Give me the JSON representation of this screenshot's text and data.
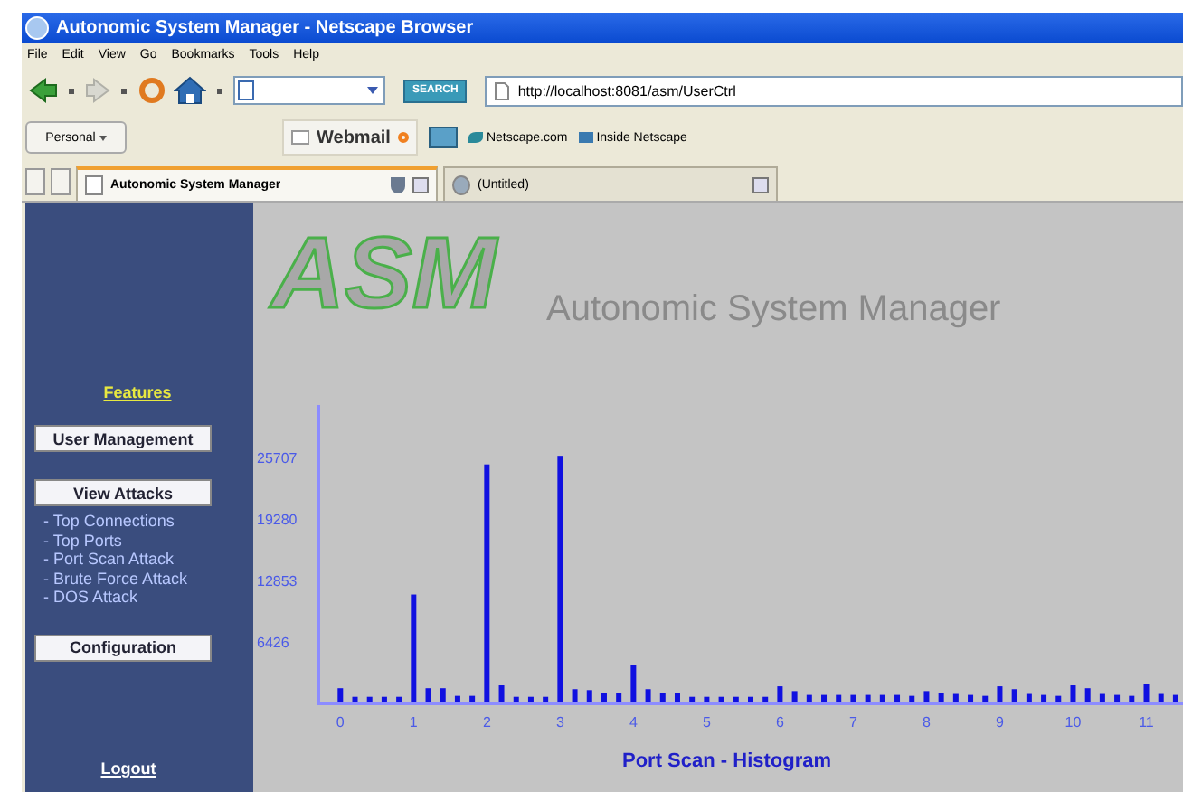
{
  "window": {
    "title": "Autonomic System Manager - Netscape Browser"
  },
  "menu": [
    "File",
    "Edit",
    "View",
    "Go",
    "Bookmarks",
    "Tools",
    "Help"
  ],
  "toolbar": {
    "search_button": "SEARCH",
    "address": "http://localhost:8081/asm/UserCtrl"
  },
  "personal_toolbar": {
    "personal": "Personal",
    "webmail": "Webmail",
    "links": [
      "Netscape.com",
      "Inside Netscape"
    ]
  },
  "tabs": [
    {
      "label": "Autonomic System Manager",
      "selected": true
    },
    {
      "label": "(Untitled)",
      "selected": false
    }
  ],
  "sidebar": {
    "items": [
      {
        "kind": "heading",
        "label": "Features"
      },
      {
        "kind": "button",
        "label": "User Management"
      },
      {
        "kind": "button",
        "label": "View Attacks"
      },
      {
        "kind": "link",
        "label": "- Top Connections"
      },
      {
        "kind": "link",
        "label": "- Top Ports"
      },
      {
        "kind": "link",
        "label": "- Port Scan Attack"
      },
      {
        "kind": "link",
        "label": "- Brute Force Attack"
      },
      {
        "kind": "link",
        "label": "- DOS Attack"
      },
      {
        "kind": "button",
        "label": "Configuration"
      },
      {
        "kind": "logout",
        "label": "Logout"
      }
    ]
  },
  "header": {
    "logo": "ASM",
    "title": "Autonomic System Manager"
  },
  "histogram": {
    "chart_data": {
      "type": "bar",
      "title": "Port Scan - Histogram",
      "x": [
        0,
        0.2,
        0.4,
        0.6,
        0.8,
        1,
        1.2,
        1.4,
        1.6,
        1.8,
        2,
        2.2,
        2.4,
        2.6,
        2.8,
        3,
        3.2,
        3.4,
        3.6,
        3.8,
        4,
        4.2,
        4.4,
        4.6,
        4.8,
        5,
        5.2,
        5.4,
        5.6,
        5.8,
        6,
        6.2,
        6.4,
        6.6,
        6.8,
        7,
        7.2,
        7.4,
        7.6,
        7.8,
        8,
        8.2,
        8.4,
        8.6,
        8.8,
        9,
        9.2,
        9.4,
        9.6,
        9.8,
        10,
        10.2,
        10.4,
        10.6,
        10.8,
        11,
        11.2,
        11.4
      ],
      "values": [
        1400,
        500,
        500,
        500,
        500,
        11200,
        1400,
        1400,
        600,
        600,
        24800,
        1700,
        500,
        500,
        500,
        25700,
        1300,
        1200,
        900,
        900,
        3800,
        1300,
        900,
        900,
        500,
        500,
        500,
        500,
        500,
        500,
        1600,
        1100,
        700,
        700,
        700,
        700,
        700,
        700,
        700,
        600,
        1100,
        900,
        800,
        700,
        600,
        1600,
        1300,
        800,
        700,
        600,
        1700,
        1400,
        800,
        700,
        600,
        1800,
        800,
        700
      ],
      "xticks": [
        0,
        1,
        2,
        3,
        4,
        5,
        6,
        7,
        8,
        9,
        10,
        11
      ],
      "yticks": [
        6426,
        12853,
        19280,
        25707
      ],
      "ylim": [
        0,
        31200
      ],
      "xlim": [
        -0.3,
        11.5
      ]
    }
  }
}
